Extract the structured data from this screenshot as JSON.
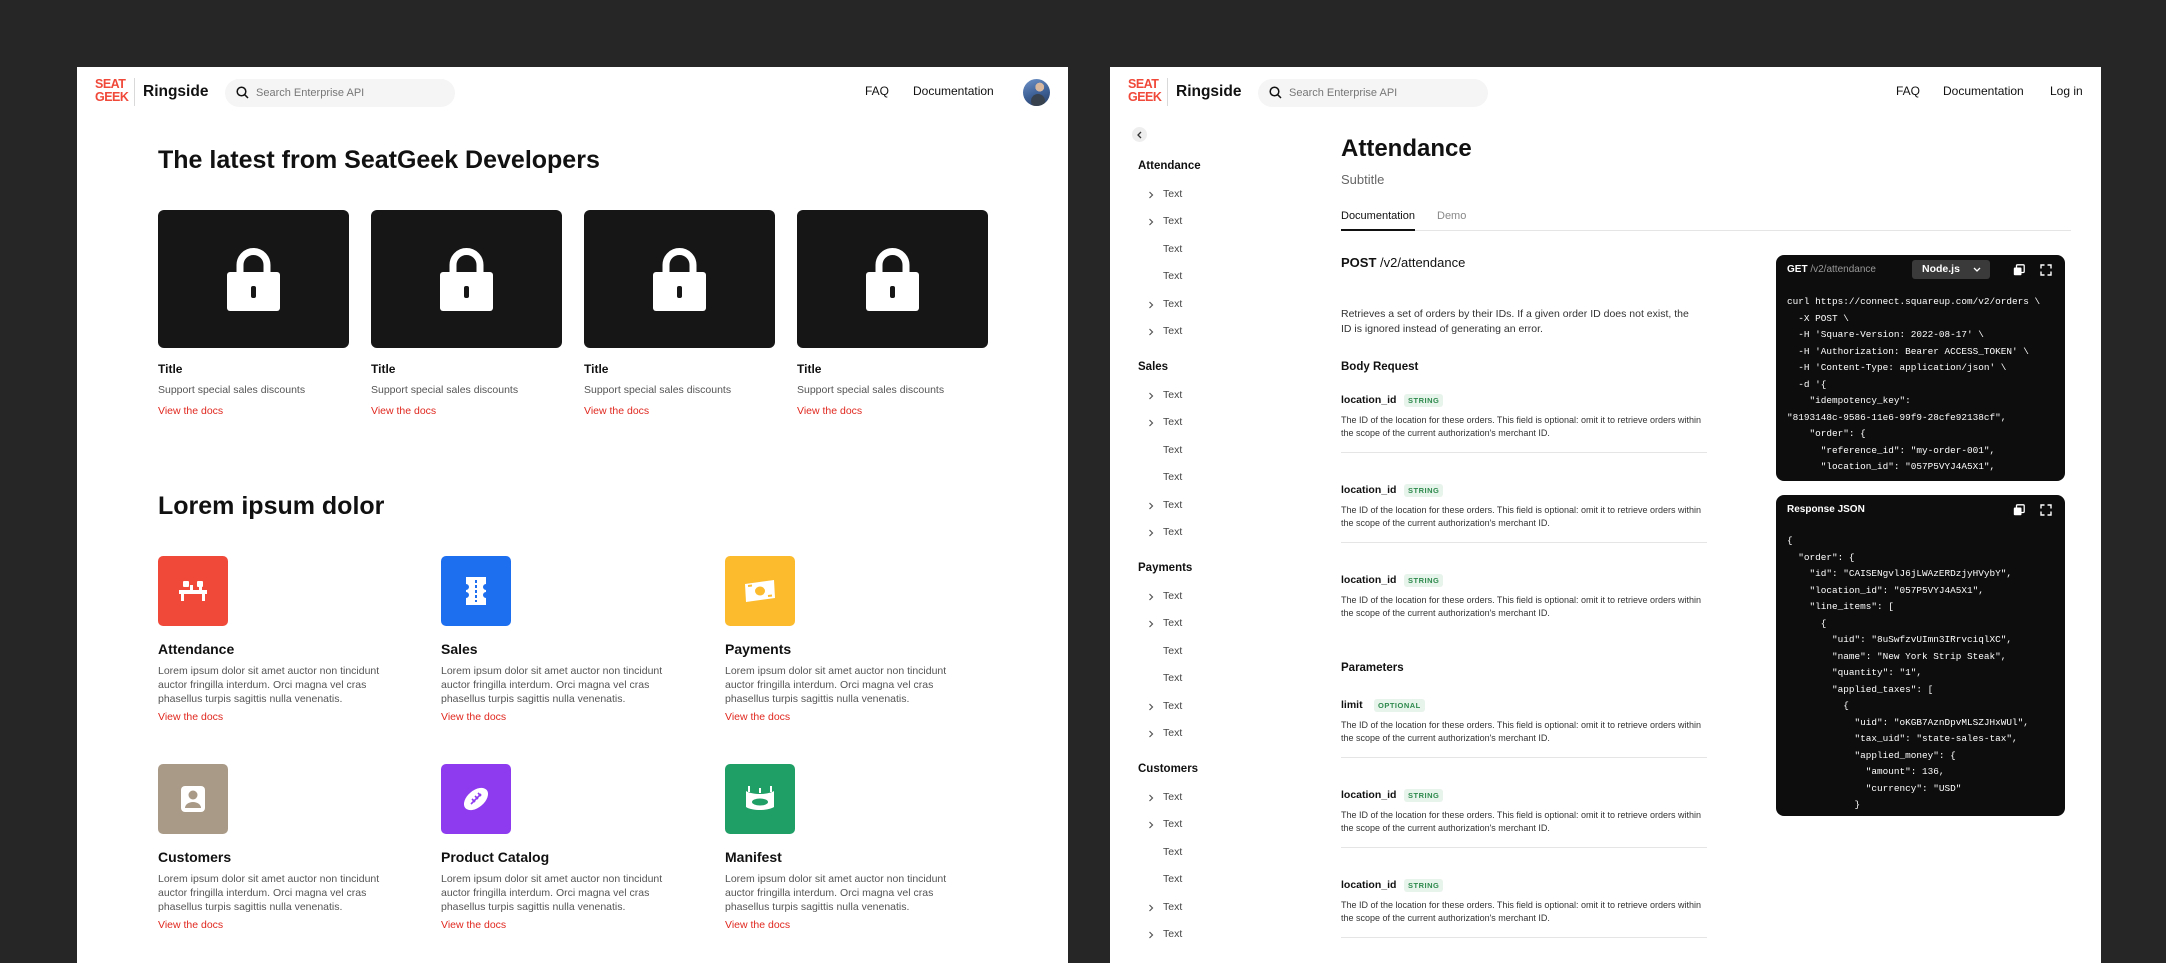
{
  "left": {
    "header": {
      "logo": "SEAT GEEK",
      "brand": "Ringside",
      "search_placeholder": "Search Enterprise API",
      "nav": [
        "FAQ",
        "Documentation"
      ]
    },
    "latest": {
      "title": "The latest from SeatGeek Developers",
      "cards": [
        {
          "title": "Title",
          "subtitle": "Support special sales discounts",
          "link": "View the docs"
        },
        {
          "title": "Title",
          "subtitle": "Support special sales discounts",
          "link": "View the docs"
        },
        {
          "title": "Title",
          "subtitle": "Support special sales discounts",
          "link": "View the docs"
        },
        {
          "title": "Title",
          "subtitle": "Support special sales discounts",
          "link": "View the docs"
        }
      ]
    },
    "lorem": {
      "title": "Lorem ipsum dolor",
      "features": [
        {
          "title": "Attendance",
          "desc": "Lorem ipsum dolor sit amet auctor non tincidunt auctor fringilla interdum. Orci magna vel cras phasellus turpis sagittis nulla venenatis.",
          "link": "View the docs",
          "color": "#f0493a",
          "icon": "seats-icon"
        },
        {
          "title": "Sales",
          "desc": "Lorem ipsum dolor sit amet auctor non tincidunt auctor fringilla interdum. Orci magna vel cras phasellus turpis sagittis nulla venenatis.",
          "link": "View the docs",
          "color": "#1d6ff0",
          "icon": "ticket-icon"
        },
        {
          "title": "Payments",
          "desc": "Lorem ipsum dolor sit amet auctor non tincidunt auctor fringilla interdum. Orci magna vel cras phasellus turpis sagittis nulla venenatis.",
          "link": "View the docs",
          "color": "#fcbb2c",
          "icon": "money-icon"
        },
        {
          "title": "Customers",
          "desc": "Lorem ipsum dolor sit amet auctor non tincidunt auctor fringilla interdum. Orci magna vel cras phasellus turpis sagittis nulla venenatis.",
          "link": "View the docs",
          "color": "#a99a87",
          "icon": "person-icon"
        },
        {
          "title": "Product Catalog",
          "desc": "Lorem ipsum dolor sit amet auctor non tincidunt auctor fringilla interdum. Orci magna vel cras phasellus turpis sagittis nulla venenatis.",
          "link": "View the docs",
          "color": "#8e3bf0",
          "icon": "football-icon"
        },
        {
          "title": "Manifest",
          "desc": "Lorem ipsum dolor sit amet auctor non tincidunt auctor fringilla interdum. Orci magna vel cras phasellus turpis sagittis nulla venenatis.",
          "link": "View the docs",
          "color": "#1f9e66",
          "icon": "stadium-icon"
        }
      ]
    }
  },
  "right": {
    "header": {
      "logo": "SEAT GEEK",
      "brand": "Ringside",
      "search_placeholder": "Search Enterprise API",
      "nav": [
        "FAQ",
        "Documentation",
        "Log in"
      ]
    },
    "sidebar": {
      "groups": [
        {
          "title": "Attendance",
          "items": [
            "Text",
            "Text",
            "Text",
            "Text",
            "Text",
            "Text"
          ]
        },
        {
          "title": "Sales",
          "items": [
            "Text",
            "Text",
            "Text",
            "Text",
            "Text",
            "Text"
          ]
        },
        {
          "title": "Payments",
          "items": [
            "Text",
            "Text",
            "Text",
            "Text",
            "Text",
            "Text"
          ]
        },
        {
          "title": "Customers",
          "items": [
            "Text",
            "Text",
            "Text",
            "Text",
            "Text",
            "Text"
          ]
        }
      ]
    },
    "page": {
      "title": "Attendance",
      "subtitle": "Subtitle",
      "tabs": [
        "Documentation",
        "Demo"
      ],
      "method": "POST",
      "path": "/v2/attendance",
      "description": "Retrieves a set of orders by their IDs. If a given order ID does not exist, the ID is ignored instead of generating an error.",
      "body_request_title": "Body Request",
      "body_fields": [
        {
          "name": "location_id",
          "badge": "STRING",
          "desc": "The ID of the location for these orders. This field is optional: omit it to retrieve orders within the scope of the current authorization's merchant ID."
        },
        {
          "name": "location_id",
          "badge": "STRING",
          "desc": "The ID of the location for these orders. This field is optional: omit it to retrieve orders within the scope of the current authorization's merchant ID."
        },
        {
          "name": "location_id",
          "badge": "STRING",
          "desc": "The ID of the location for these orders. This field is optional: omit it to retrieve orders within the scope of the current authorization's merchant ID."
        }
      ],
      "parameters_title": "Parameters",
      "param_fields": [
        {
          "name": "limit",
          "badge": "OPTIONAL",
          "desc": "The ID of the location for these orders. This field is optional: omit it to retrieve orders within the scope of the current authorization's merchant ID."
        },
        {
          "name": "location_id",
          "badge": "STRING",
          "desc": "The ID of the location for these orders. This field is optional: omit it to retrieve orders within the scope of the current authorization's merchant ID."
        },
        {
          "name": "location_id",
          "badge": "STRING",
          "desc": "The ID of the location for these orders. This field is optional: omit it to retrieve orders within the scope of the current authorization's merchant ID."
        }
      ]
    },
    "request_code": {
      "method": "GET",
      "path": "/v2/attendance",
      "language": "Node.js",
      "code": "curl https://connect.squareup.com/v2/orders \\\n  -X POST \\\n  -H 'Square-Version: 2022-08-17' \\\n  -H 'Authorization: Bearer ACCESS_TOKEN' \\\n  -H 'Content-Type: application/json' \\\n  -d '{\n    \"idempotency_key\":\n\"8193148c-9586-11e6-99f9-28cfe92138cf\",\n    \"order\": {\n      \"reference_id\": \"my-order-001\",\n      \"location_id\": \"057P5VYJ4A5X1\","
    },
    "response_code": {
      "title": "Response JSON",
      "code": "{\n  \"order\": {\n    \"id\": \"CAISENgvlJ6jLWAzERDzjyHVybY\",\n    \"location_id\": \"057P5VYJ4A5X1\",\n    \"line_items\": [\n      {\n        \"uid\": \"8uSwfzvUImn3IRrvciqlXC\",\n        \"name\": \"New York Strip Steak\",\n        \"quantity\": \"1\",\n        \"applied_taxes\": [\n          {\n            \"uid\": \"oKGB7AznDpvMLSZJHxWUl\",\n            \"tax_uid\": \"state-sales-tax\",\n            \"applied_money\": {\n              \"amount\": 136,\n              \"currency\": \"USD\"\n            }"
    }
  }
}
